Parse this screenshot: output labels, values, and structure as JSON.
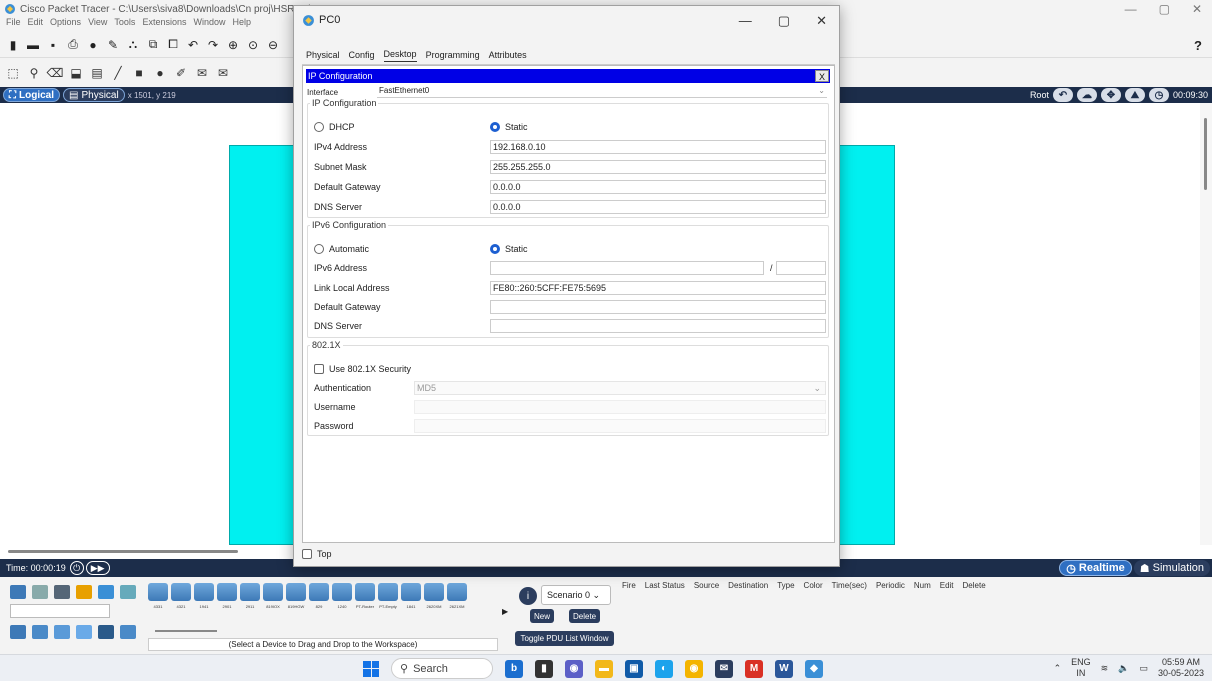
{
  "app": {
    "title": "Cisco Packet Tracer - C:\\Users\\siva8\\Downloads\\Cn proj\\HSRP.pk",
    "menu": [
      "File",
      "Edit",
      "Options",
      "View",
      "Tools",
      "Extensions",
      "Window",
      "Help"
    ],
    "help_glyph": "?",
    "navbar": {
      "logical_label": "Logical",
      "physical_label": "Physical",
      "coords": "x 1501, y 219",
      "root_label": "Root",
      "clock": "00:09:30"
    },
    "timebar": {
      "time": "Time: 00:00:19",
      "realtime_label": "Realtime",
      "simulation_label": "Simulation"
    },
    "bottom": {
      "device_hint": "(Select a Device to Drag and Drop to the Workspace)",
      "device_models": [
        "4331",
        "4321",
        "1941",
        "2901",
        "2911",
        "819IOX",
        "819HGW",
        "829",
        "1240",
        "PT-Router",
        "PT-Empty",
        "1841",
        "2620XM",
        "2621XM"
      ],
      "scenario": "Scenario 0",
      "new_label": "New",
      "delete_label": "Delete",
      "toggle_label": "Toggle PDU List Window",
      "pdu_headers": [
        "Fire",
        "Last Status",
        "Source",
        "Destination",
        "Type",
        "Color",
        "Time(sec)",
        "Periodic",
        "Num",
        "Edit",
        "Delete"
      ]
    }
  },
  "dialog": {
    "title": "PC0",
    "tabs": [
      "Physical",
      "Config",
      "Desktop",
      "Programming",
      "Attributes"
    ],
    "active_tab": "Desktop",
    "header": "IP Configuration",
    "close_label": "X",
    "interface_label": "Interface",
    "interface_value": "FastEthernet0",
    "ipv4": {
      "legend": "IP Configuration",
      "dhcp_label": "DHCP",
      "static_label": "Static",
      "ipv4_address_label": "IPv4 Address",
      "ipv4_address": "192.168.0.10",
      "subnet_label": "Subnet Mask",
      "subnet": "255.255.255.0",
      "gateway_label": "Default Gateway",
      "gateway": "0.0.0.0",
      "dns_label": "DNS Server",
      "dns": "0.0.0.0"
    },
    "ipv6": {
      "legend": "IPv6 Configuration",
      "auto_label": "Automatic",
      "static_label": "Static",
      "address_label": "IPv6 Address",
      "slash": "/",
      "link_local_label": "Link Local Address",
      "link_local": "FE80::260:5CFF:FE75:5695",
      "gateway_label": "Default Gateway",
      "dns_label": "DNS Server"
    },
    "dot1x": {
      "legend": "802.1X",
      "use_label": "Use 802.1X Security",
      "auth_label": "Authentication",
      "auth_value": "MD5",
      "user_label": "Username",
      "pass_label": "Password"
    },
    "top_label": "Top"
  },
  "taskbar": {
    "search": "Search",
    "lang_top": "ENG",
    "lang_bottom": "IN",
    "time": "05:59 AM",
    "date": "30-05-2023"
  },
  "colors": {
    "navbar": "#1c2d4a",
    "workspace_cyan": "#00f0f0",
    "ipc_header": "#0000e6",
    "accent": "#2f6fc2"
  }
}
